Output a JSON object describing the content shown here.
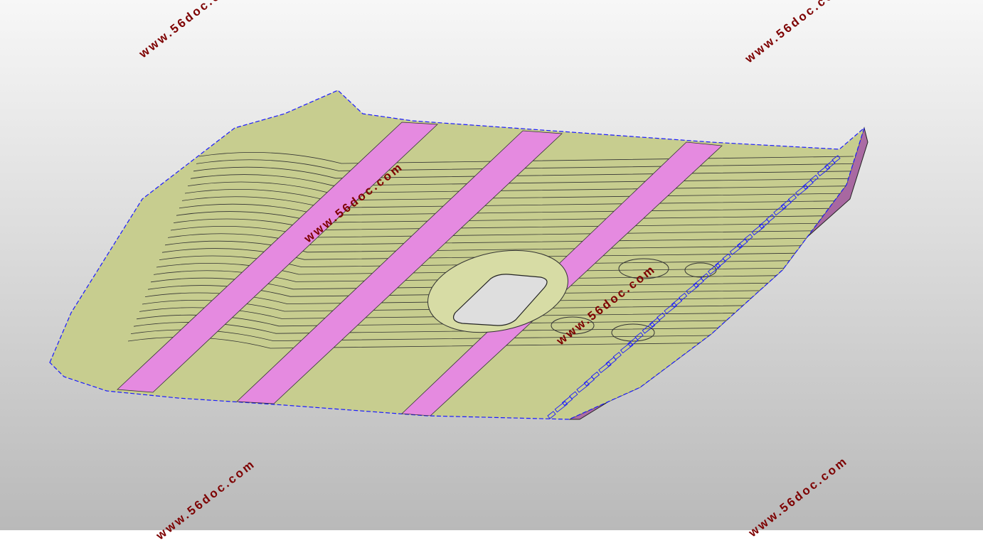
{
  "viewer": {
    "background_top": "#f7f7f7",
    "background_bottom": "#b9b9b9"
  },
  "model": {
    "panel_color": "#c7cd8f",
    "rib_color": "#e58ae0",
    "side_color": "#b06aa8",
    "outline_color": "#1a1aff",
    "edge_color": "#222222"
  },
  "watermarks": [
    {
      "text": "www.56doc.com"
    },
    {
      "text": "www.56doc.com"
    },
    {
      "text": "www.56doc.com"
    },
    {
      "text": "www.56doc.com"
    },
    {
      "text": "www.56doc.com"
    },
    {
      "text": "www.56doc.com"
    }
  ]
}
